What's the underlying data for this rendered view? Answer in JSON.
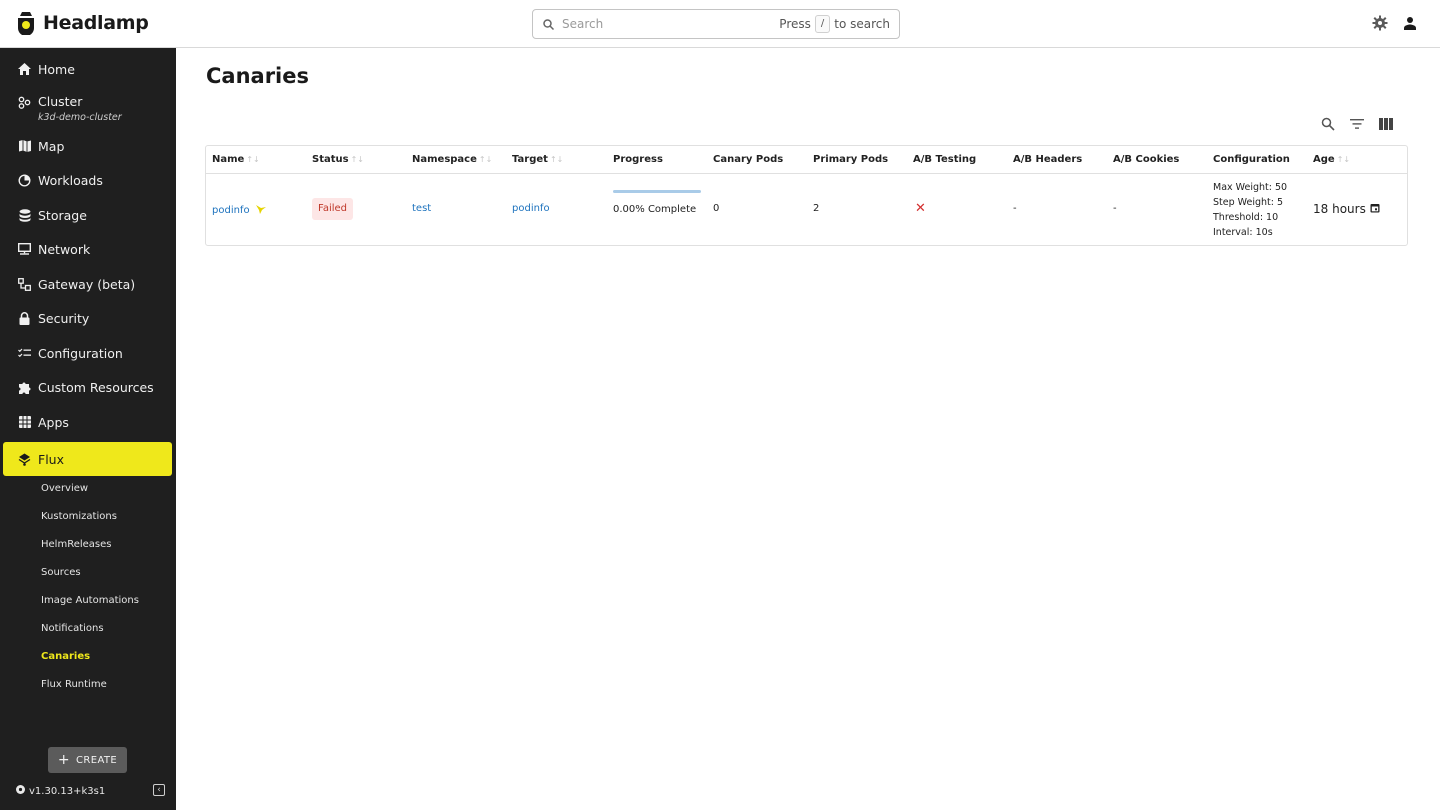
{
  "app": {
    "name": "Headlamp"
  },
  "search": {
    "placeholder": "Search",
    "hint_prefix": "Press",
    "hint_key": "/",
    "hint_suffix": "to search"
  },
  "sidebar": {
    "items": [
      {
        "label": "Home",
        "icon": "home-icon"
      },
      {
        "label": "Cluster",
        "sub": "k3d-demo-cluster",
        "icon": "cluster-icon"
      },
      {
        "label": "Map",
        "icon": "map-icon"
      },
      {
        "label": "Workloads",
        "icon": "workloads-icon"
      },
      {
        "label": "Storage",
        "icon": "storage-icon"
      },
      {
        "label": "Network",
        "icon": "network-icon"
      },
      {
        "label": "Gateway (beta)",
        "icon": "gateway-icon"
      },
      {
        "label": "Security",
        "icon": "lock-icon"
      },
      {
        "label": "Configuration",
        "icon": "configuration-icon"
      },
      {
        "label": "Custom Resources",
        "icon": "puzzle-icon"
      },
      {
        "label": "Apps",
        "icon": "apps-icon"
      },
      {
        "label": "Flux",
        "icon": "flux-icon",
        "active": true
      }
    ],
    "flux_sub_items": [
      "Overview",
      "Kustomizations",
      "HelmReleases",
      "Sources",
      "Image Automations",
      "Notifications",
      "Canaries",
      "Flux Runtime"
    ],
    "selected_sub_item": "Canaries",
    "create_label": "CREATE",
    "version": "v1.30.13+k3s1"
  },
  "page": {
    "title": "Canaries"
  },
  "table": {
    "columns": [
      "Name",
      "Status",
      "Namespace",
      "Target",
      "Progress",
      "Canary Pods",
      "Primary Pods",
      "A/B Testing",
      "A/B Headers",
      "A/B Cookies",
      "Configuration",
      "Age"
    ],
    "rows": [
      {
        "name": "podinfo",
        "status": "Failed",
        "namespace": "test",
        "target": "podinfo",
        "progress_text": "0.00% Complete",
        "progress_value": 0,
        "canary_pods": "0",
        "primary_pods": "2",
        "ab_testing": "✕",
        "ab_headers": "-",
        "ab_cookies": "-",
        "config": [
          "Max Weight: 50",
          "Step Weight: 5",
          "Threshold: 10",
          "Interval: 10s"
        ],
        "age": "18 hours"
      }
    ]
  },
  "colors": {
    "accent": "#efe81b",
    "sidebar_bg": "#1f1f1f",
    "link": "#1e73be",
    "failed_bg": "#fde6e6",
    "failed_text": "#c0392b"
  }
}
